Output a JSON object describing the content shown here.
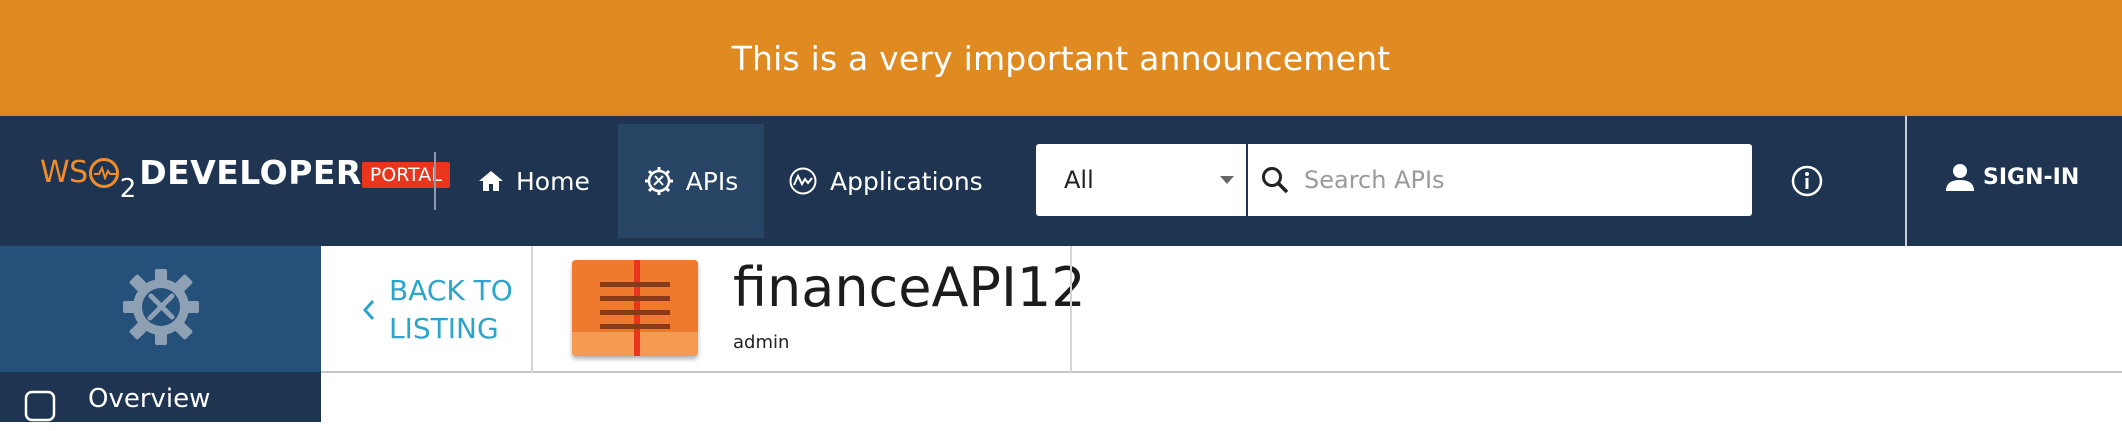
{
  "announcement": {
    "text": "This is a very important announcement",
    "bg": "#e08a22"
  },
  "appbar": {
    "bg": "#1e3450",
    "logo": {
      "wso": "WS",
      "two": "2",
      "developer": "DEVELOPER",
      "portal": "PORTAL"
    },
    "nav": [
      {
        "label": "Home",
        "icon": "home-icon",
        "active": false
      },
      {
        "label": "APIs",
        "icon": "gear-cog-icon",
        "active": true
      },
      {
        "label": "Applications",
        "icon": "applications-icon",
        "active": false
      }
    ],
    "search": {
      "filter_value": "All",
      "placeholder": "Search APIs",
      "value": ""
    },
    "info_icon": "info-icon",
    "signin_label": "SIGN-IN"
  },
  "sidebar": {
    "top_icon": "api-settings-gear-icon",
    "items": [
      {
        "label": "Overview",
        "icon": "overview-icon"
      }
    ]
  },
  "api_header": {
    "back_line1": "BACK TO",
    "back_line2": "LISTING",
    "name": "financeAPI12",
    "owner": "admin",
    "thumbnail_color": "#ef7a2d"
  }
}
